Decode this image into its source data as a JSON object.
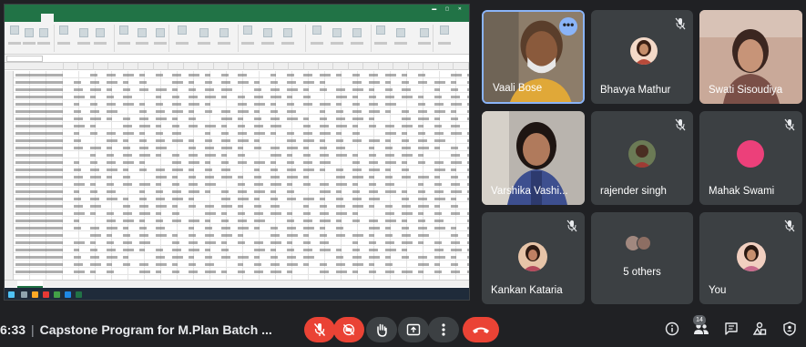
{
  "meeting": {
    "time": "6:33",
    "title": "Capstone Program for M.Plan Batch ..."
  },
  "participants": [
    {
      "name": "Vaali Bose",
      "muted": false,
      "video": true
    },
    {
      "name": "Bhavya Mathur",
      "muted": true,
      "video": false
    },
    {
      "name": "Swati Sisoudiya",
      "muted": true,
      "video": true
    },
    {
      "name": "Varshika Vashi...",
      "muted": false,
      "video": true
    },
    {
      "name": "rajender singh",
      "muted": true,
      "video": false
    },
    {
      "name": "Mahak Swami",
      "muted": true,
      "video": false
    },
    {
      "name": "Kankan Kataria",
      "muted": true,
      "video": false
    },
    {
      "name": "5 others",
      "muted": false,
      "video": false
    },
    {
      "name": "You",
      "muted": true,
      "video": false
    }
  ],
  "people_count": "14",
  "colors": {
    "background": "#202124",
    "tile": "#3c4043",
    "danger": "#ea4335",
    "excel_green": "#217346",
    "accent_blue": "#8ab4f8"
  },
  "icons": {
    "controls": [
      "mic-off-icon",
      "camera-off-icon",
      "raise-hand-icon",
      "present-icon",
      "more-options-icon",
      "end-call-icon"
    ],
    "right": [
      "info-icon",
      "people-icon",
      "chat-icon",
      "activities-icon",
      "host-controls-icon"
    ]
  }
}
